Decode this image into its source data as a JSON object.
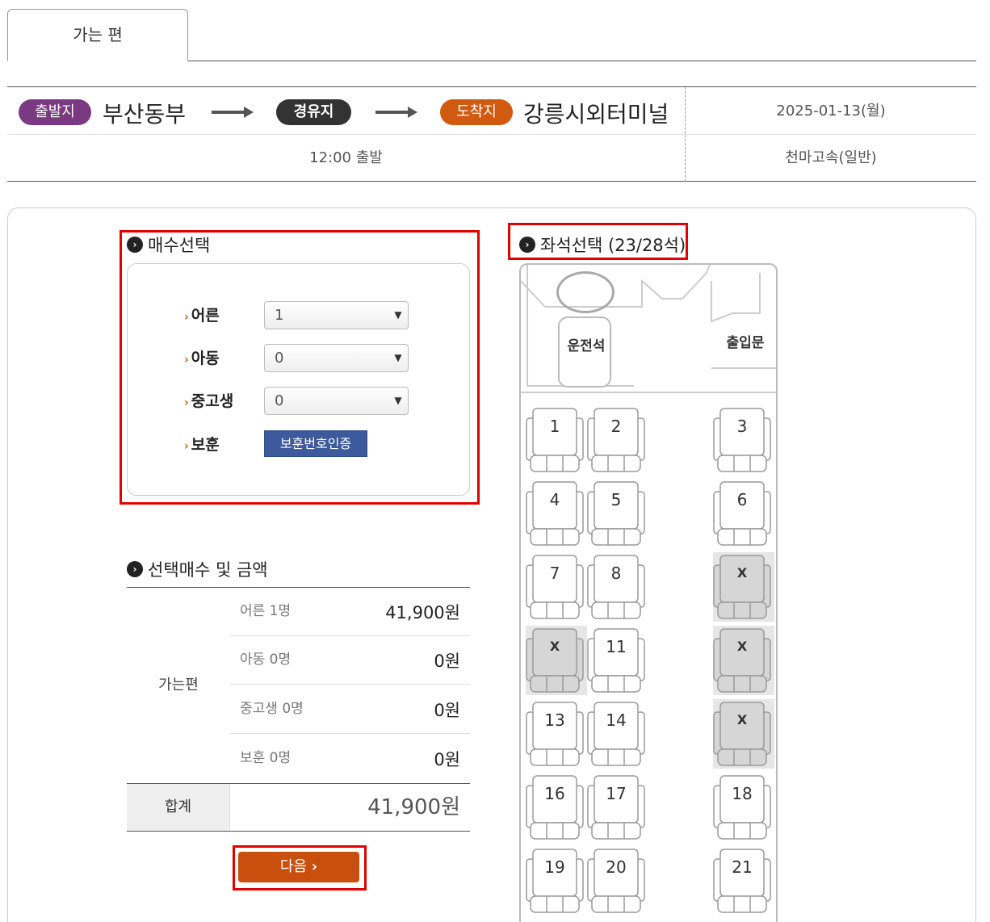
{
  "tabs": {
    "active": "가는 편"
  },
  "route": {
    "departure_badge": "출발지",
    "departure_city": "부산동부",
    "via_badge": "경유지",
    "arrival_badge": "도착지",
    "arrival_city": "강릉시외터미널",
    "date": "2025-01-13(월)",
    "departure_time": "12:00 출발",
    "company": "천마고속(일반)"
  },
  "ticket_select": {
    "title": "매수선택",
    "rows": [
      {
        "label": "어른",
        "value": "1"
      },
      {
        "label": "아동",
        "value": "0"
      },
      {
        "label": "중고생",
        "value": "0"
      }
    ],
    "veteran_label": "보훈",
    "veteran_button": "보훈번호인증"
  },
  "price_summary": {
    "title": "선택매수 및 금액",
    "group_label": "가는편",
    "rows": [
      {
        "name": "어른 1명",
        "amount": "41,900원"
      },
      {
        "name": "아동 0명",
        "amount": "0원"
      },
      {
        "name": "중고생 0명",
        "amount": "0원"
      },
      {
        "name": "보훈 0명",
        "amount": "0원"
      }
    ],
    "total_label": "합계",
    "total_amount": "41,900원"
  },
  "next_button": "다음",
  "seat_select": {
    "title": "좌석선택 (23/28석)",
    "driver_label": "운전석",
    "door_label": "출입문",
    "taken_mark": "X",
    "seats": [
      {
        "label": "1",
        "taken": false
      },
      {
        "label": "2",
        "taken": false
      },
      {
        "label": "3",
        "taken": false
      },
      {
        "label": "4",
        "taken": false
      },
      {
        "label": "5",
        "taken": false
      },
      {
        "label": "6",
        "taken": false
      },
      {
        "label": "7",
        "taken": false
      },
      {
        "label": "8",
        "taken": false
      },
      {
        "label": "X",
        "taken": true
      },
      {
        "label": "X",
        "taken": true
      },
      {
        "label": "11",
        "taken": false
      },
      {
        "label": "X",
        "taken": true
      },
      {
        "label": "13",
        "taken": false
      },
      {
        "label": "14",
        "taken": false
      },
      {
        "label": "X",
        "taken": true
      },
      {
        "label": "16",
        "taken": false
      },
      {
        "label": "17",
        "taken": false
      },
      {
        "label": "18",
        "taken": false
      },
      {
        "label": "19",
        "taken": false
      },
      {
        "label": "20",
        "taken": false
      },
      {
        "label": "21",
        "taken": false
      }
    ]
  },
  "colors": {
    "departure": "#7a3a82",
    "via": "#333333",
    "arrival": "#d05a10",
    "next_button": "#c84f0e",
    "veteran_button": "#3c5a9c",
    "highlight": "#e00000"
  }
}
